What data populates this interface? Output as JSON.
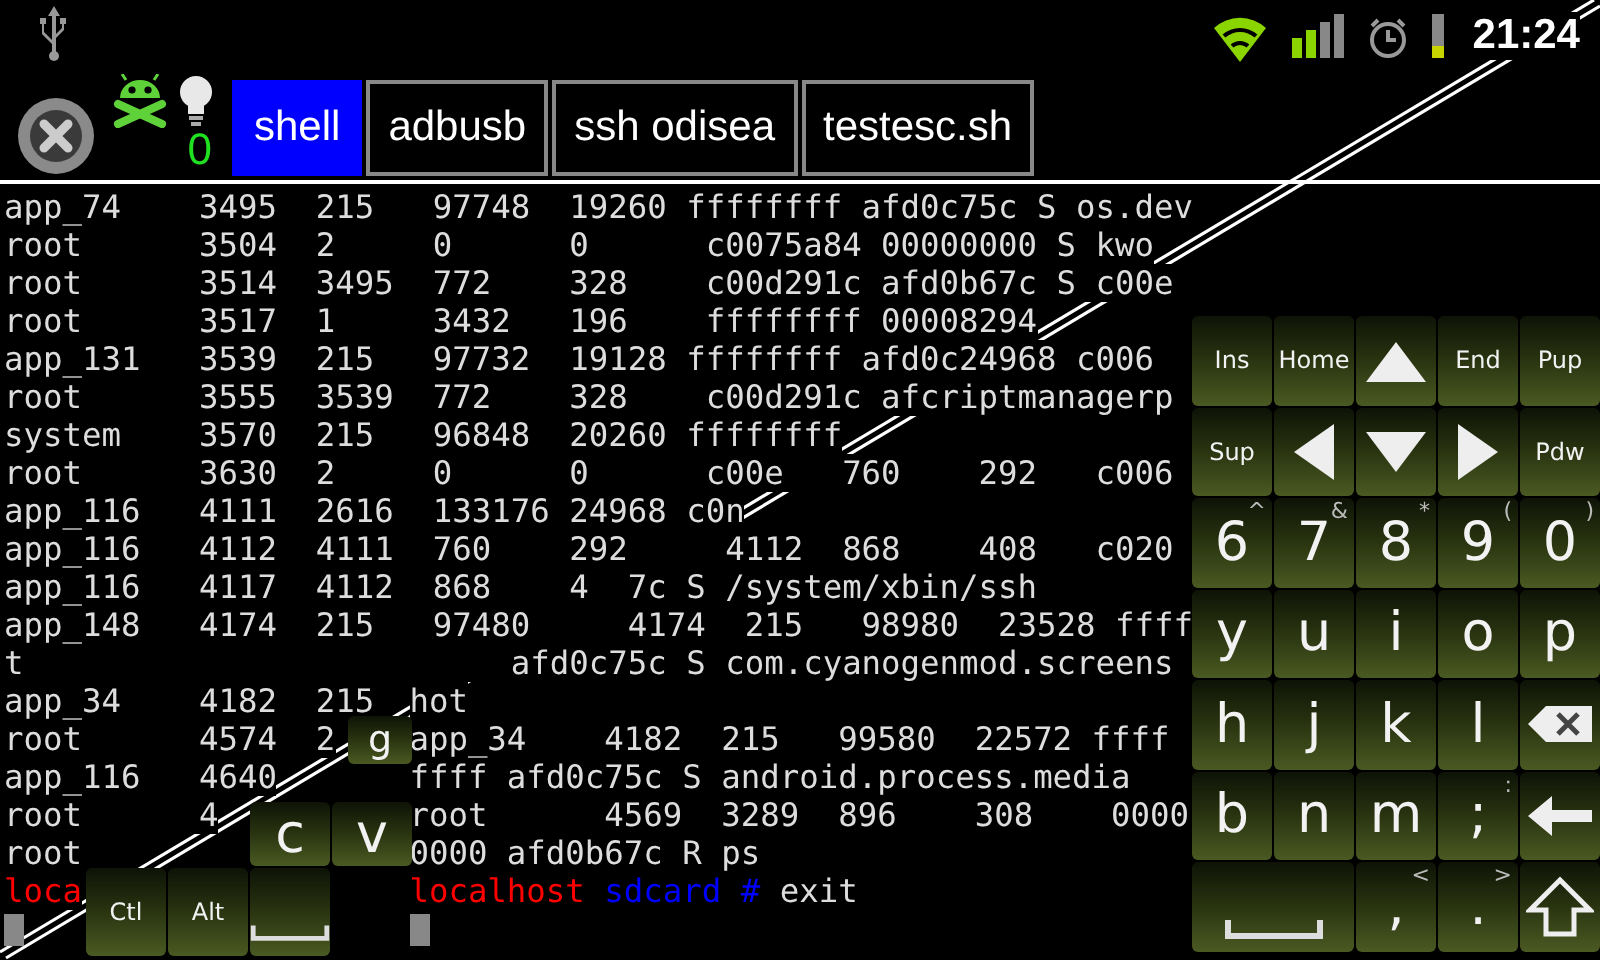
{
  "status_bar": {
    "time": "21:24"
  },
  "toolbar": {
    "counter": "0",
    "tabs": [
      {
        "label": "shell",
        "selected": true
      },
      {
        "label": "adbusb",
        "selected": false
      },
      {
        "label": "ssh odisea",
        "selected": false
      },
      {
        "label": "testesc.sh",
        "selected": false
      }
    ]
  },
  "terminal": {
    "rows": [
      {
        "spans": [
          {
            "kind": "text",
            "text": "app_74    3495  215   97748  19260 ffffffff afd0c75c S os.dev"
          }
        ]
      },
      {
        "spans": [
          {
            "kind": "text",
            "text": "root      3504  2     0      0      c0075a84 00000000 S kwo"
          }
        ]
      },
      {
        "spans": [
          {
            "kind": "text",
            "text": "root      3514  3495  772    328    c00d291c afd0b67c S c00e"
          }
        ]
      },
      {
        "spans": [
          {
            "kind": "text",
            "text": "root      3517  1     3432   196    ffffffff 00008294"
          }
        ]
      },
      {
        "spans": [
          {
            "kind": "text",
            "text": "app_131   3539  215   97732  19128 ffffffff afd0c24968 c006"
          }
        ]
      },
      {
        "spans": [
          {
            "kind": "text",
            "text": "root      3555  3539  772    328    c00d291c afcriptmanagerp"
          }
        ]
      },
      {
        "spans": [
          {
            "kind": "text",
            "text": "system    3570  215   96848  20260 ffffffff"
          }
        ]
      },
      {
        "spans": [
          {
            "kind": "text",
            "text": "root      3630  2     0      0      c00e   760    292   c006"
          }
        ]
      },
      {
        "spans": [
          {
            "kind": "text",
            "text": "app_116   4111  2616  133176 24968 c0n"
          }
        ]
      },
      {
        "spans": [
          {
            "kind": "text",
            "text": "app_116   4112  4111  760    292     4112  868    408   c020"
          }
        ]
      },
      {
        "spans": [
          {
            "kind": "text",
            "text": "app_116   4117  4112  868    4  7c S /system/xbin/ssh"
          }
        ]
      },
      {
        "spans": [
          {
            "kind": "text",
            "text": "app_148   4174  215   97480     4174  215   98980  23528 ffff"
          }
        ]
      },
      {
        "spans": [
          {
            "kind": "text",
            "text": "t                         afd0c75c S com.cyanogenmod.screens"
          }
        ]
      },
      {
        "spans": [
          {
            "kind": "text",
            "text": "app_34    4182  215"
          },
          {
            "kind": "text",
            "text": "hot"
          }
        ]
      },
      {
        "spans": [
          {
            "kind": "text",
            "text": "root      4574  2"
          },
          {
            "kind": "text",
            "text": "app_34    4182  215   99580  22572 ffff"
          }
        ]
      },
      {
        "spans": [
          {
            "kind": "text",
            "text": "app_116   4640"
          },
          {
            "kind": "text",
            "text": "ffff afd0c75c S android.process.media"
          }
        ]
      },
      {
        "spans": [
          {
            "kind": "text",
            "text": "root      4"
          },
          {
            "kind": "text",
            "text": "root      4569  3289  896    308    0000"
          }
        ]
      },
      {
        "spans": [
          {
            "kind": "text",
            "text": "root"
          },
          {
            "kind": "text",
            "text": "0000 afd0b67c R ps"
          }
        ]
      },
      {
        "spans": [
          {
            "kind": "prompt",
            "segments": [
              {
                "text": "loca",
                "color": "#ff0000"
              }
            ]
          },
          {
            "kind": "prompt",
            "segments": [
              {
                "text": "localhost",
                "color": "#ff0000"
              },
              {
                "text": " sdcard #",
                "color": "#0000ff"
              },
              {
                "text": " exit"
              }
            ]
          }
        ]
      },
      {
        "spans": [
          {
            "kind": "cursor"
          },
          {
            "kind": "cursor"
          }
        ]
      }
    ]
  },
  "left_keypad": {
    "keys": [
      {
        "kind": "char",
        "label": "g"
      },
      {
        "kind": "char",
        "label": "c"
      },
      {
        "kind": "char",
        "label": "v"
      },
      {
        "kind": "small",
        "label": "Ctl"
      },
      {
        "kind": "small",
        "label": "Alt"
      },
      {
        "kind": "space"
      }
    ]
  },
  "keypad": {
    "keys": [
      {
        "kind": "small",
        "label": "Ins"
      },
      {
        "kind": "small",
        "label": "Home"
      },
      {
        "kind": "up"
      },
      {
        "kind": "small",
        "label": "End"
      },
      {
        "kind": "small",
        "label": "Pup"
      },
      {
        "kind": "small",
        "label": "Sup"
      },
      {
        "kind": "left"
      },
      {
        "kind": "down"
      },
      {
        "kind": "right"
      },
      {
        "kind": "small",
        "label": "Pdw"
      },
      {
        "kind": "char",
        "label": "6",
        "shift": "^"
      },
      {
        "kind": "char",
        "label": "7",
        "shift": "&"
      },
      {
        "kind": "char",
        "label": "8",
        "shift": "*"
      },
      {
        "kind": "char",
        "label": "9",
        "shift": "("
      },
      {
        "kind": "char",
        "label": "0",
        "shift": ")"
      },
      {
        "kind": "char",
        "label": "y"
      },
      {
        "kind": "char",
        "label": "u"
      },
      {
        "kind": "char",
        "label": "i"
      },
      {
        "kind": "char",
        "label": "o"
      },
      {
        "kind": "char",
        "label": "p"
      },
      {
        "kind": "char",
        "label": "h"
      },
      {
        "kind": "char",
        "label": "j"
      },
      {
        "kind": "char",
        "label": "k"
      },
      {
        "kind": "char",
        "label": "l"
      },
      {
        "kind": "backspace"
      },
      {
        "kind": "char",
        "label": "b"
      },
      {
        "kind": "char",
        "label": "n"
      },
      {
        "kind": "char",
        "label": "m"
      },
      {
        "kind": "char",
        "label": ";",
        "shift": ":"
      },
      {
        "kind": "enter"
      },
      {
        "kind": "space"
      },
      {
        "kind": "char",
        "label": ",",
        "shift": "<"
      },
      {
        "kind": "char",
        "label": ".",
        "shift": ">"
      },
      {
        "kind": "shift"
      }
    ]
  }
}
